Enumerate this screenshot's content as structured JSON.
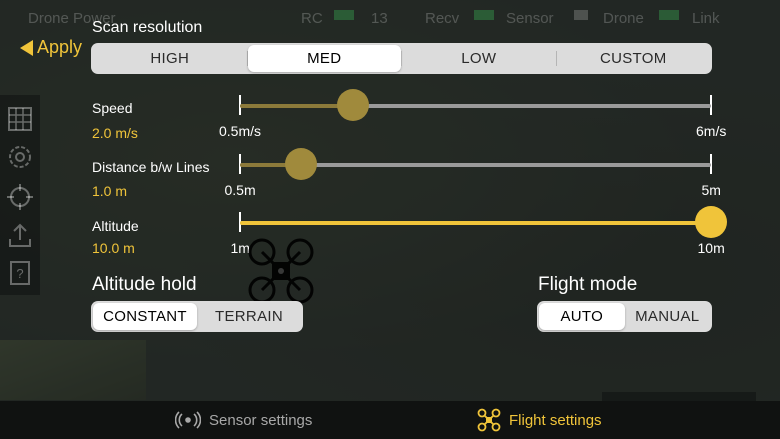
{
  "colors": {
    "accent": "#f0c43a",
    "accent_dim": "#8c7a3a",
    "track": "#9a9a9a",
    "inactive_text": "#a8a8a8"
  },
  "status_bar": {
    "app_name": "Drone Power",
    "rc_label": "RC",
    "satellites": "13",
    "recv_label": "Recv",
    "sensor_label": "Sensor",
    "drone_label": "Drone",
    "link_label": "Link"
  },
  "left_rail": {
    "icons": [
      "grid-icon",
      "gear-sync-icon",
      "crosshair-icon",
      "upload-icon",
      "help-book-icon"
    ]
  },
  "apply_label": "Apply",
  "scan_resolution": {
    "title": "Scan resolution",
    "options": [
      "HIGH",
      "MED",
      "LOW",
      "CUSTOM"
    ],
    "selected": "MED"
  },
  "sliders": {
    "speed": {
      "label": "Speed",
      "value": "2.0 m/s",
      "min_label": "0.5m/s",
      "max_label": "6m/s",
      "level": 0.24,
      "active": false
    },
    "distance": {
      "label": "Distance b/w Lines",
      "value": "1.0 m",
      "min_label": "0.5m",
      "max_label": "5m",
      "level": 0.13,
      "active": false
    },
    "altitude": {
      "label": "Altitude",
      "value": "10.0 m",
      "min_label": "1m",
      "max_label": "10m",
      "level": 1.0,
      "active": true
    }
  },
  "altitude_hold": {
    "title": "Altitude hold",
    "options": [
      "CONSTANT",
      "TERRAIN"
    ],
    "selected": "CONSTANT"
  },
  "flight_mode": {
    "title": "Flight mode",
    "options": [
      "AUTO",
      "MANUAL"
    ],
    "selected": "AUTO"
  },
  "bottom_bar": {
    "sensor_settings": "Sensor settings",
    "flight_settings": "Flight settings",
    "active_tab": "flight"
  }
}
